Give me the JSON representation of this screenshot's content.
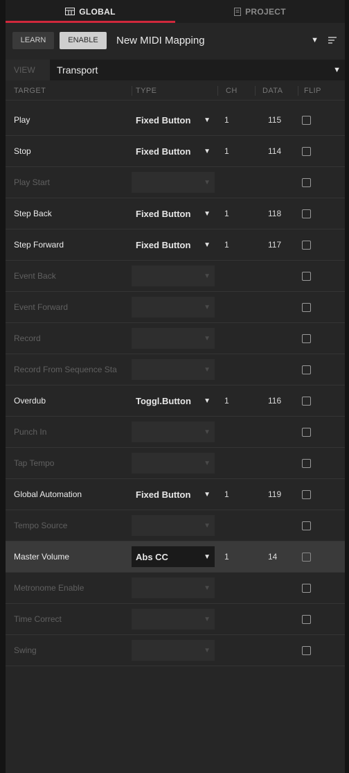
{
  "tabs": [
    {
      "label": "GLOBAL",
      "icon": "grid-icon",
      "active": true
    },
    {
      "label": "PROJECT",
      "icon": "document-icon",
      "active": false
    }
  ],
  "toolbar": {
    "learn_label": "LEARN",
    "enable_label": "ENABLE",
    "mapping_name": "New MIDI Mapping"
  },
  "view": {
    "label": "VIEW",
    "value": "Transport"
  },
  "columns": {
    "target": "TARGET",
    "type": "TYPE",
    "ch": "CH",
    "data": "DATA",
    "flip": "FLIP"
  },
  "rows": [
    {
      "target": "Play",
      "type": "Fixed Button",
      "ch": "1",
      "data": "115",
      "enabled": true
    },
    {
      "target": "Stop",
      "type": "Fixed Button",
      "ch": "1",
      "data": "114",
      "enabled": true
    },
    {
      "target": "Play Start",
      "type": "",
      "ch": "",
      "data": "",
      "enabled": false
    },
    {
      "target": "Step Back",
      "type": "Fixed Button",
      "ch": "1",
      "data": "118",
      "enabled": true
    },
    {
      "target": "Step Forward",
      "type": "Fixed Button",
      "ch": "1",
      "data": "117",
      "enabled": true
    },
    {
      "target": "Event Back",
      "type": "",
      "ch": "",
      "data": "",
      "enabled": false
    },
    {
      "target": "Event Forward",
      "type": "",
      "ch": "",
      "data": "",
      "enabled": false
    },
    {
      "target": "Record",
      "type": "",
      "ch": "",
      "data": "",
      "enabled": false
    },
    {
      "target": "Record From Sequence Sta",
      "type": "",
      "ch": "",
      "data": "",
      "enabled": false
    },
    {
      "target": "Overdub",
      "type": "Toggl.Button",
      "ch": "1",
      "data": "116",
      "enabled": true
    },
    {
      "target": "Punch In",
      "type": "",
      "ch": "",
      "data": "",
      "enabled": false
    },
    {
      "target": "Tap Tempo",
      "type": "",
      "ch": "",
      "data": "",
      "enabled": false
    },
    {
      "target": "Global Automation",
      "type": "Fixed Button",
      "ch": "1",
      "data": "119",
      "enabled": true
    },
    {
      "target": "Tempo Source",
      "type": "",
      "ch": "",
      "data": "",
      "enabled": false
    },
    {
      "target": "Master Volume",
      "type": "Abs CC",
      "ch": "1",
      "data": "14",
      "enabled": true,
      "selected": true
    },
    {
      "target": "Metronome Enable",
      "type": "",
      "ch": "",
      "data": "",
      "enabled": false
    },
    {
      "target": "Time Correct",
      "type": "",
      "ch": "",
      "data": "",
      "enabled": false
    },
    {
      "target": "Swing",
      "type": "",
      "ch": "",
      "data": "",
      "enabled": false
    }
  ],
  "colors": {
    "accent": "#d1283c",
    "background": "#262626"
  }
}
